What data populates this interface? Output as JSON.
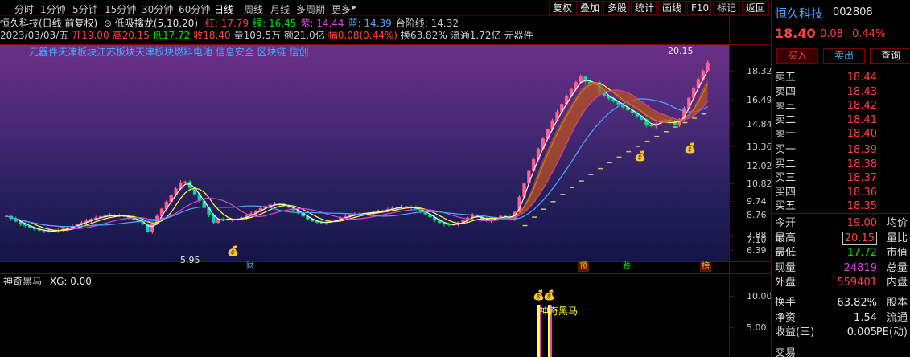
{
  "toolbar": {
    "periods": [
      "分时",
      "1分钟",
      "5分钟",
      "15分钟",
      "30分钟",
      "60分钟",
      "日线",
      "周线",
      "月线",
      "多周期",
      "更多"
    ],
    "active_period": "日线",
    "more_arrow": "▸",
    "right_buttons": [
      "复权",
      "叠加",
      "多股",
      "统计",
      "画线",
      "F10",
      "标记",
      "返回"
    ]
  },
  "header": {
    "title": "恒久科技(日线 前复权)",
    "indicator_name": "低吸擒龙(5,10,20)",
    "indicator_values": [
      {
        "label": "红: 17.79",
        "color": "#ff4040"
      },
      {
        "label": "绿: 16.45",
        "color": "#00e000"
      },
      {
        "label": "紫: 14.44",
        "color": "#e040e0"
      },
      {
        "label": "蓝: 14.39",
        "color": "#4da6ff"
      },
      {
        "label": "台阶线: 14.32",
        "color": "#c8c8c8"
      }
    ],
    "ohlc": [
      {
        "text": "2023/03/03/五",
        "color": "#c8c8c8"
      },
      {
        "text": "开19.00",
        "color": "#ff4040"
      },
      {
        "text": "高20.15",
        "color": "#ff4040"
      },
      {
        "text": "低17.72",
        "color": "#00e000"
      },
      {
        "text": "收18.40",
        "color": "#ff4040"
      },
      {
        "text": "量109.5万",
        "color": "#c8c8c8"
      },
      {
        "text": "额21.0亿",
        "color": "#c8c8c8"
      },
      {
        "text": "幅0.08(0.44%)",
        "color": "#ff4040"
      },
      {
        "text": "换63.82%",
        "color": "#c8c8c8"
      },
      {
        "text": "流通1.72亿",
        "color": "#c8c8c8"
      },
      {
        "text": "元器件",
        "color": "#c8c8c8"
      }
    ],
    "concepts": "元器件天津板块江苏板块天津板块燃料电池 信息安全 区块链 信创"
  },
  "main_chart": {
    "y_axis_labels": [
      "18.32",
      "16.49",
      "14.84",
      "13.36",
      "12.02",
      "10.82",
      "9.74",
      "8.76",
      "7.88",
      "7.10",
      "6.39"
    ],
    "high_label": "20.15",
    "low_label": "5.95",
    "markers": [
      {
        "text": "财",
        "color": "#4da6ff"
      },
      {
        "text": "预",
        "color": "#ffb040"
      },
      {
        "text": "跌",
        "color": "#00e000"
      },
      {
        "text": "榜",
        "color": "#ffb040"
      }
    ]
  },
  "indicator_panel": {
    "title": "神奇黑马",
    "value": "XG: 0.00",
    "signal_label": "神奇黑马",
    "y_axis_labels": [
      "10.00",
      "5.00"
    ]
  },
  "quote": {
    "name": "恒久科技",
    "code": "002808",
    "price": "18.40",
    "change": "0.08",
    "change_pct": "0.44%",
    "buttons": [
      "买入",
      "卖出",
      "查询"
    ],
    "sell": [
      {
        "label": "卖五",
        "price": "18.44"
      },
      {
        "label": "卖四",
        "price": "18.43"
      },
      {
        "label": "卖三",
        "price": "18.42"
      },
      {
        "label": "卖二",
        "price": "18.41"
      },
      {
        "label": "卖一",
        "price": "18.40"
      }
    ],
    "buy": [
      {
        "label": "买一",
        "price": "18.39"
      },
      {
        "label": "买二",
        "price": "18.38"
      },
      {
        "label": "买三",
        "price": "18.37"
      },
      {
        "label": "买四",
        "price": "18.36"
      },
      {
        "label": "买五",
        "price": "18.35"
      }
    ],
    "stats": [
      {
        "label": "今开",
        "value": "19.00",
        "value_color": "#ff4040",
        "label2": "均价"
      },
      {
        "label": "最高",
        "value": "20.15",
        "value_color": "#ff4040",
        "label2": "量比",
        "boxed": true
      },
      {
        "label": "最低",
        "value": "17.72",
        "value_color": "#00e000",
        "label2": "市值"
      },
      {
        "label": "现量",
        "value": "24819",
        "value_color": "#e040e0",
        "label2": "总量"
      },
      {
        "label": "外盘",
        "value": "559401",
        "value_color": "#ff4040",
        "label2": "内盘"
      }
    ],
    "stats2": [
      {
        "label": "换手",
        "value": "63.82%",
        "value_color": "#e6e6e6",
        "label2": "股本"
      },
      {
        "label": "净资",
        "value": "1.54",
        "value_color": "#e6e6e6",
        "label2": "流通"
      },
      {
        "label": "收益(三)",
        "value": "0.005",
        "value_color": "#e6e6e6",
        "label2": "PE(动)"
      }
    ],
    "last_label": "交易"
  },
  "colors": {
    "up": "#ff4040",
    "down": "#00e000",
    "ma_white": "#ffffff",
    "ma_yellow": "#ffff40",
    "ma_magenta": "#e040e0",
    "ma_blue": "#4da6ff"
  }
}
